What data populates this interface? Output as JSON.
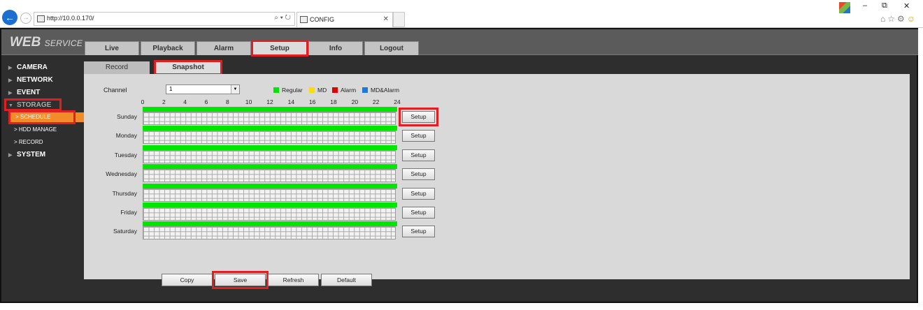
{
  "browser": {
    "url": "http://10.0.0.170/",
    "tab_title": "CONFIG",
    "address_tools": "⌕ ▾ ↻",
    "nav": {
      "back": "←",
      "forward": "→"
    },
    "window_controls": {
      "minimize": "–",
      "restore": "⧉",
      "close": "✕"
    },
    "toolbar_icons": {
      "home": "⌂",
      "favorites": "☆",
      "settings": "⚙",
      "feedback": "☺"
    }
  },
  "app": {
    "logo": {
      "main": "WEB",
      "sub": "SERVICE"
    },
    "main_tabs": [
      "Live",
      "Playback",
      "Alarm",
      "Setup",
      "Info",
      "Logout"
    ],
    "active_main_tab": "Setup",
    "sidebar": {
      "camera": "CAMERA",
      "network": "NETWORK",
      "event": "EVENT",
      "storage": "STORAGE",
      "schedule": "SCHEDULE",
      "hdd_manage": "HDD MANAGE",
      "record": "RECORD",
      "system": "SYSTEM",
      "collapsed_marker": "▶",
      "expanded_marker": "▼",
      "sub_marker": ">"
    },
    "sub_tabs": {
      "record": "Record",
      "snapshot": "Snapshot",
      "active": "Snapshot"
    },
    "schedule": {
      "channel_label": "Channel",
      "channel_value": "1",
      "legend": [
        {
          "label": "Regular",
          "color": "#00e600"
        },
        {
          "label": "MD",
          "color": "#ffdd00"
        },
        {
          "label": "Alarm",
          "color": "#e00000"
        },
        {
          "label": "MD&Alarm",
          "color": "#1e7ad6"
        }
      ],
      "hour_labels": [
        "0",
        "2",
        "4",
        "6",
        "8",
        "10",
        "12",
        "14",
        "16",
        "18",
        "20",
        "22",
        "24"
      ],
      "days": [
        {
          "name": "Sunday",
          "regular_fraction": 1.0
        },
        {
          "name": "Monday",
          "regular_fraction": 1.0
        },
        {
          "name": "Tuesday",
          "regular_fraction": 1.0
        },
        {
          "name": "Wednesday",
          "regular_fraction": 1.0
        },
        {
          "name": "Thursday",
          "regular_fraction": 1.0
        },
        {
          "name": "Friday",
          "regular_fraction": 1.0
        },
        {
          "name": "Saturday",
          "regular_fraction": 1.0
        }
      ],
      "setup_label": "Setup",
      "buttons": {
        "copy": "Copy",
        "save": "Save",
        "refresh": "Refresh",
        "default": "Default"
      }
    }
  }
}
